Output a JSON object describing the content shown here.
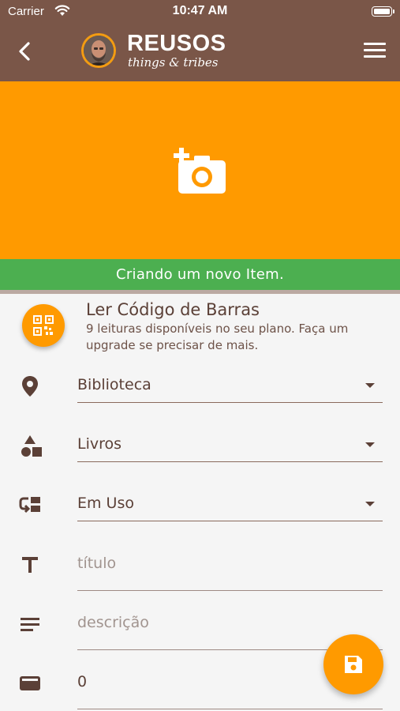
{
  "status_bar": {
    "carrier": "Carrier",
    "time": "10:47 AM"
  },
  "header": {
    "brand_title": "REUSOS",
    "brand_subtitle": "things & tribes"
  },
  "banner": {
    "text": "Criando um novo Item."
  },
  "barcode": {
    "title": "Ler Código de Barras",
    "description": "9 leituras disponíveis no seu plano. Faça um upgrade se precisar de mais."
  },
  "form": {
    "location": {
      "value": "Biblioteca",
      "icon": "location-pin-icon"
    },
    "category": {
      "value": "Livros",
      "icon": "category-shapes-icon"
    },
    "status": {
      "value": "Em Uso",
      "icon": "status-swap-icon"
    },
    "title": {
      "placeholder": "título",
      "icon": "text-title-icon"
    },
    "description": {
      "placeholder": "descrição",
      "icon": "text-lines-icon"
    },
    "price": {
      "value": "0",
      "icon": "wallet-icon"
    }
  },
  "colors": {
    "header_brown": "#7a5648",
    "accent_orange": "#ff9a00",
    "banner_green": "#4caf50",
    "text_brown": "#5b4037"
  }
}
